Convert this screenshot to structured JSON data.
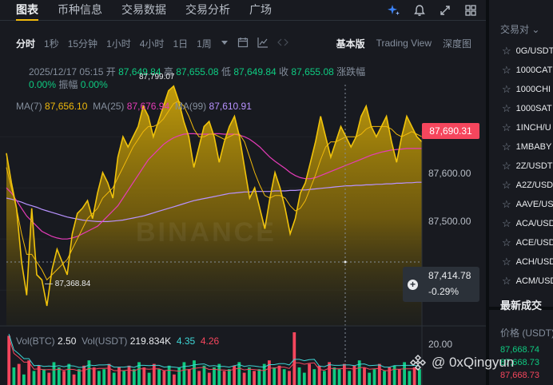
{
  "topnav": {
    "tabs": [
      "图表",
      "币种信息",
      "交易数据",
      "交易分析",
      "广场"
    ],
    "active_index": 0
  },
  "toolbar": {
    "intervals": [
      "分时",
      "1秒",
      "15分钟",
      "1小时",
      "4小时",
      "1日",
      "1周"
    ],
    "active_interval": "分时",
    "views": [
      "基本版",
      "Trading View",
      "深度图"
    ],
    "active_view": "基本版"
  },
  "ohlc": {
    "datetime": "2025/12/17 05:15",
    "open_label": "开",
    "open": "87,649.84",
    "high_label": "高",
    "high": "87,655.08",
    "low_label": "低",
    "low": "87,649.84",
    "close_label": "收",
    "close": "87,655.08",
    "change_label": "涨跌幅",
    "change": "0.00%",
    "amp_label": "振幅",
    "amp": "0.00%"
  },
  "ma": {
    "ma7_label": "MA(7)",
    "ma7": "87,656.10",
    "ma25_label": "MA(25)",
    "ma25": "87,676.94",
    "ma99_label": "MA(99)",
    "ma99": "87,610.91"
  },
  "volume": {
    "btc_label": "Vol(BTC)",
    "btc": "2.50",
    "usdt_label": "Vol(USDT)",
    "usdt": "219.834K",
    "v1": "4.35",
    "v2": "4.26",
    "axis_label": "20.00"
  },
  "price_axis": {
    "ticks": [
      "87,600.00",
      "87,500.00"
    ],
    "current_price": "87,690.31",
    "cursor_price": "87,414.78",
    "cursor_change": "-0.29%"
  },
  "annotations": {
    "low": "87,368.84",
    "high": "87,799.07"
  },
  "chart_data": {
    "type": "area",
    "price_range": [
      87330,
      87830
    ],
    "price_points": [
      87668,
      87610,
      87560,
      87455,
      87390,
      87560,
      87430,
      87420,
      87369,
      87440,
      87480,
      87455,
      87430,
      87510,
      87550,
      87560,
      87575,
      87540,
      87590,
      87630,
      87610,
      87580,
      87660,
      87700,
      87680,
      87700,
      87720,
      87760,
      87740,
      87700,
      87730,
      87760,
      87790,
      87799,
      87770,
      87730,
      87700,
      87640,
      87680,
      87720,
      87730,
      87700,
      87650,
      87690,
      87720,
      87740,
      87700,
      87640,
      87580,
      87600,
      87560,
      87520,
      87580,
      87630,
      87600,
      87560,
      87510,
      87540,
      87590,
      87610,
      87650,
      87690,
      87740,
      87700,
      87660,
      87690,
      87720,
      87700,
      87680,
      87700,
      87740,
      87760,
      87720,
      87700,
      87720,
      87740,
      87690,
      87650,
      87700,
      87740,
      87720,
      87700,
      87690
    ],
    "ma7_points": [
      87640,
      87600,
      87560,
      87510,
      87470,
      87470,
      87455,
      87440,
      87420,
      87430,
      87440,
      87450,
      87460,
      87480,
      87500,
      87520,
      87540,
      87550,
      87560,
      87580,
      87590,
      87600,
      87620,
      87640,
      87660,
      87680,
      87695,
      87710,
      87720,
      87720,
      87725,
      87735,
      87750,
      87765,
      87770,
      87760,
      87740,
      87715,
      87700,
      87700,
      87705,
      87705,
      87700,
      87695,
      87700,
      87705,
      87705,
      87690,
      87660,
      87630,
      87605,
      87585,
      87580,
      87585,
      87585,
      87580,
      87565,
      87555,
      87560,
      87575,
      87600,
      87625,
      87655,
      87680,
      87690,
      87690,
      87695,
      87700,
      87700,
      87700,
      87705,
      87715,
      87720,
      87720,
      87720,
      87720,
      87715,
      87705,
      87700,
      87705,
      87710,
      87705,
      87700
    ],
    "ma25_points": [
      87600,
      87590,
      87575,
      87560,
      87545,
      87535,
      87525,
      87515,
      87510,
      87505,
      87502,
      87500,
      87500,
      87502,
      87505,
      87510,
      87515,
      87520,
      87525,
      87535,
      87545,
      87555,
      87565,
      87580,
      87595,
      87610,
      87625,
      87640,
      87655,
      87665,
      87675,
      87685,
      87692,
      87698,
      87702,
      87705,
      87706,
      87706,
      87705,
      87705,
      87705,
      87706,
      87706,
      87705,
      87705,
      87705,
      87703,
      87700,
      87695,
      87688,
      87680,
      87670,
      87660,
      87652,
      87645,
      87638,
      87630,
      87624,
      87620,
      87618,
      87618,
      87620,
      87624,
      87628,
      87632,
      87636,
      87640,
      87644,
      87648,
      87652,
      87656,
      87660,
      87664,
      87667,
      87670,
      87672,
      87674,
      87675,
      87676,
      87677,
      87677,
      87677,
      87677
    ],
    "ma99_points": [
      87580,
      87578,
      87575,
      87572,
      87568,
      87565,
      87562,
      87558,
      87555,
      87552,
      87549,
      87546,
      87543,
      87541,
      87539,
      87537,
      87536,
      87535,
      87534,
      87534,
      87534,
      87535,
      87536,
      87537,
      87539,
      87541,
      87543,
      87545,
      87548,
      87551,
      87554,
      87557,
      87560,
      87563,
      87566,
      87569,
      87572,
      87575,
      87577,
      87579,
      87581,
      87583,
      87585,
      87587,
      87589,
      87590,
      87591,
      87592,
      87592,
      87593,
      87593,
      87593,
      87593,
      87594,
      87594,
      87594,
      87595,
      87595,
      87596,
      87596,
      87597,
      87598,
      87599,
      87600,
      87601,
      87602,
      87603,
      87604,
      87604,
      87605,
      87605,
      87606,
      87606,
      87607,
      87607,
      87608,
      87608,
      87609,
      87609,
      87610,
      87610,
      87611,
      87611
    ],
    "volume_range": [
      0,
      30
    ],
    "volumes": [
      28,
      10,
      12,
      6,
      14,
      8,
      11,
      9,
      7,
      13,
      10,
      8,
      12,
      6,
      9,
      11,
      14,
      10,
      8,
      9,
      12,
      7,
      10,
      8,
      11,
      9,
      13,
      10,
      7,
      12,
      9,
      8,
      11,
      6,
      10,
      13,
      9,
      14,
      8,
      11,
      7,
      10,
      12,
      8,
      9,
      11,
      13,
      7,
      10,
      8,
      9,
      12,
      14,
      10,
      11,
      9,
      8,
      30,
      10,
      7,
      12,
      9,
      11,
      8,
      13,
      10,
      9,
      12,
      8,
      11,
      14,
      10,
      7,
      9,
      12,
      8,
      10,
      11,
      9,
      13,
      8,
      10,
      9
    ],
    "volume_up": [
      false,
      true,
      false,
      true,
      false,
      true,
      false,
      true,
      false,
      true,
      true,
      false,
      true,
      false,
      true,
      false,
      true,
      false,
      true,
      true,
      false,
      true,
      false,
      true,
      false,
      true,
      true,
      false,
      true,
      false,
      true,
      false,
      true,
      false,
      true,
      true,
      false,
      true,
      false,
      true,
      false,
      true,
      true,
      false,
      true,
      false,
      true,
      false,
      true,
      false,
      true,
      true,
      false,
      true,
      false,
      true,
      false,
      false,
      true,
      true,
      false,
      true,
      false,
      true,
      false,
      true,
      true,
      false,
      true,
      false,
      true,
      false,
      true,
      true,
      false,
      true,
      false,
      true,
      false,
      true,
      true,
      false,
      true
    ]
  },
  "right_panel": {
    "header": "交易对",
    "pairs": [
      "0G/USDT",
      "1000CAT",
      "1000CHI",
      "1000SAT",
      "1INCH/U",
      "1MBABY",
      "2Z/USDT",
      "A2Z/USD",
      "AAVE/US",
      "ACA/USD",
      "ACE/USD",
      "ACH/USD",
      "ACM/USD"
    ],
    "trades_title": "最新成交",
    "price_header": "价格 (USDT)",
    "trades": [
      {
        "price": "87,668.74",
        "side": "buy"
      },
      {
        "price": "87,668.73",
        "side": "buy"
      },
      {
        "price": "87,668.73",
        "side": "sell"
      }
    ]
  },
  "watermark": {
    "handle": "@ 0xQingyun",
    "bg_text": "BINANCE"
  },
  "colors": {
    "accent": "#f0b90b",
    "up": "#0ecb81",
    "down": "#f6465d",
    "ma25": "#e63cb8",
    "ma99": "#b892ff"
  }
}
